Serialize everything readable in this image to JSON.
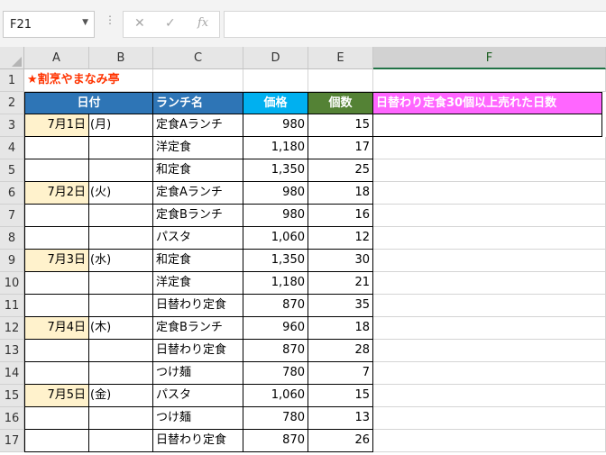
{
  "formula_bar": {
    "name_box": "F21",
    "cancel_icon": "✕",
    "enter_icon": "✓",
    "fx_label": "fx",
    "formula": ""
  },
  "sheet": {
    "columns": [
      "A",
      "B",
      "C",
      "D",
      "E",
      "F"
    ],
    "selected_column": "F",
    "title": "★割烹やまなみ亭",
    "headers": {
      "date": "日付",
      "menu": "ランチ名",
      "price": "価格",
      "count": "個数",
      "result": "日替わり定食30個以上売れた日数"
    },
    "header_colors": {
      "date": "#2e75b6",
      "menu": "#2e75b6",
      "price": "#00b0f0",
      "count": "#548235",
      "result": "#ff66ff"
    },
    "date_fill": "#fff2cc",
    "title_color": "#ff3300",
    "rows": [
      {
        "num": "1"
      },
      {
        "num": "2"
      },
      {
        "num": "3",
        "date": "7月1日",
        "day": "(月)",
        "menu": "定食Aランチ",
        "price": "980",
        "count": "15"
      },
      {
        "num": "4",
        "date": "",
        "day": "",
        "menu": "洋定食",
        "price": "1,180",
        "count": "17"
      },
      {
        "num": "5",
        "date": "",
        "day": "",
        "menu": "和定食",
        "price": "1,350",
        "count": "25"
      },
      {
        "num": "6",
        "date": "7月2日",
        "day": "(火)",
        "menu": "定食Aランチ",
        "price": "980",
        "count": "18"
      },
      {
        "num": "7",
        "date": "",
        "day": "",
        "menu": "定食Bランチ",
        "price": "980",
        "count": "16"
      },
      {
        "num": "8",
        "date": "",
        "day": "",
        "menu": "パスタ",
        "price": "1,060",
        "count": "12"
      },
      {
        "num": "9",
        "date": "7月3日",
        "day": "(水)",
        "menu": "和定食",
        "price": "1,350",
        "count": "30"
      },
      {
        "num": "10",
        "date": "",
        "day": "",
        "menu": "洋定食",
        "price": "1,180",
        "count": "21"
      },
      {
        "num": "11",
        "date": "",
        "day": "",
        "menu": "日替わり定食",
        "price": "870",
        "count": "35"
      },
      {
        "num": "12",
        "date": "7月4日",
        "day": "(木)",
        "menu": "定食Bランチ",
        "price": "960",
        "count": "18"
      },
      {
        "num": "13",
        "date": "",
        "day": "",
        "menu": "日替わり定食",
        "price": "870",
        "count": "28"
      },
      {
        "num": "14",
        "date": "",
        "day": "",
        "menu": "つけ麺",
        "price": "780",
        "count": "7"
      },
      {
        "num": "15",
        "date": "7月5日",
        "day": "(金)",
        "menu": "パスタ",
        "price": "1,060",
        "count": "15"
      },
      {
        "num": "16",
        "date": "",
        "day": "",
        "menu": "つけ麺",
        "price": "780",
        "count": "13"
      },
      {
        "num": "17",
        "date": "",
        "day": "",
        "menu": "日替わり定食",
        "price": "870",
        "count": "26"
      }
    ]
  }
}
